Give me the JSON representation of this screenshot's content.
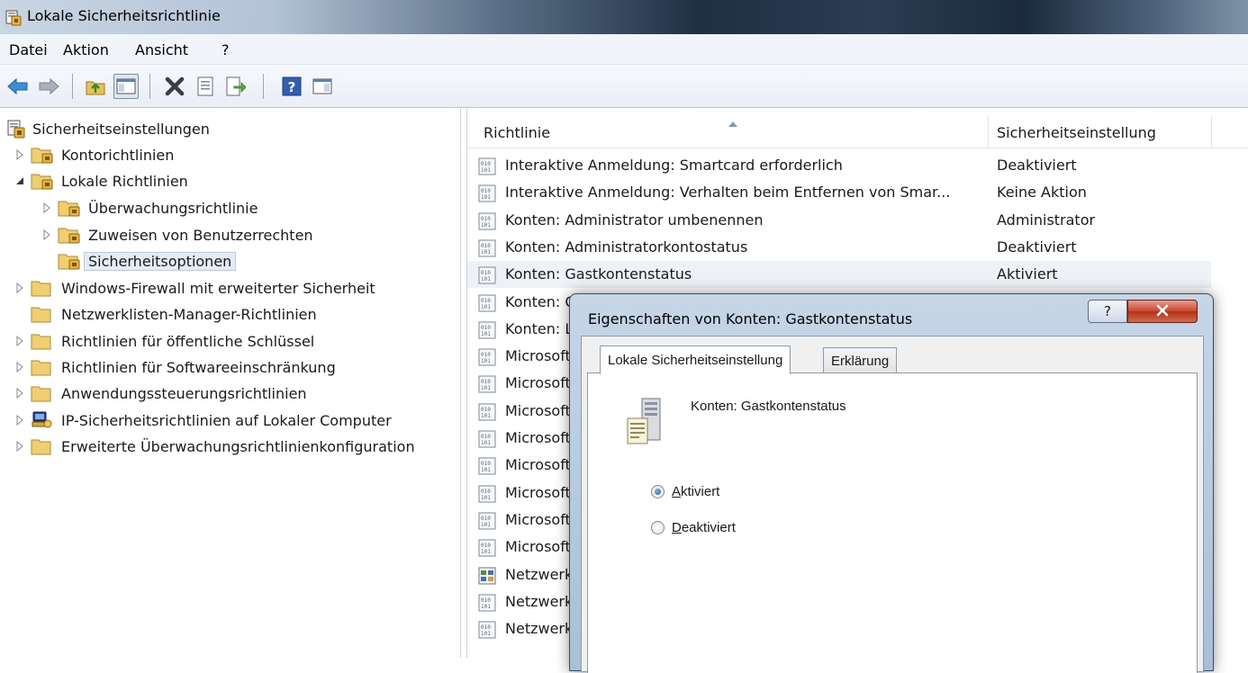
{
  "window": {
    "title": "Lokale Sicherheitsrichtlinie",
    "icon": "security-policy-icon"
  },
  "menu": {
    "items": [
      "Datei",
      "Aktion",
      "Ansicht",
      "?"
    ]
  },
  "toolbar": {
    "buttons": [
      "back-arrow-icon",
      "forward-arrow-icon",
      "up-folder-icon",
      "show-hide-tree-icon",
      "delete-icon",
      "properties-icon",
      "export-list-icon",
      "help-icon",
      "action-pane-icon"
    ]
  },
  "tree": {
    "items": [
      {
        "label": "Sicherheitseinstellungen",
        "icon": "security-settings-icon",
        "level": 0,
        "arrow": "none"
      },
      {
        "label": "Kontorichtlinien",
        "icon": "policy-folder-icon",
        "level": 1,
        "arrow": "collapsed"
      },
      {
        "label": "Lokale Richtlinien",
        "icon": "policy-folder-icon",
        "level": 1,
        "arrow": "expanded"
      },
      {
        "label": "Überwachungsrichtlinie",
        "icon": "policy-folder-icon",
        "level": 2,
        "arrow": "collapsed"
      },
      {
        "label": "Zuweisen von Benutzerrechten",
        "icon": "policy-folder-icon",
        "level": 2,
        "arrow": "collapsed"
      },
      {
        "label": "Sicherheitsoptionen",
        "icon": "policy-folder-icon",
        "level": 2,
        "arrow": "none",
        "selected": true
      },
      {
        "label": "Windows-Firewall mit erweiterter Sicherheit",
        "icon": "folder-icon",
        "level": 1,
        "arrow": "collapsed"
      },
      {
        "label": "Netzwerklisten-Manager-Richtlinien",
        "icon": "folder-icon",
        "level": 1,
        "arrow": "none"
      },
      {
        "label": "Richtlinien für öffentliche Schlüssel",
        "icon": "folder-icon",
        "level": 1,
        "arrow": "collapsed"
      },
      {
        "label": "Richtlinien für Softwareeinschränkung",
        "icon": "folder-icon",
        "level": 1,
        "arrow": "collapsed"
      },
      {
        "label": "Anwendungssteuerungsrichtlinien",
        "icon": "folder-icon",
        "level": 1,
        "arrow": "collapsed"
      },
      {
        "label": "IP-Sicherheitsrichtlinien auf Lokaler Computer",
        "icon": "ip-security-icon",
        "level": 1,
        "arrow": "collapsed"
      },
      {
        "label": "Erweiterte Überwachungsrichtlinienkonfiguration",
        "icon": "folder-icon",
        "level": 1,
        "arrow": "collapsed"
      }
    ]
  },
  "list": {
    "columns": [
      "Richtlinie",
      "Sicherheitseinstellung"
    ],
    "rows": [
      {
        "name": "Interaktive Anmeldung: Smartcard erforderlich",
        "value": "Deaktiviert"
      },
      {
        "name": "Interaktive Anmeldung: Verhalten beim Entfernen von Smar...",
        "value": "Keine Aktion"
      },
      {
        "name": "Konten: Administrator umbenennen",
        "value": "Administrator"
      },
      {
        "name": "Konten: Administratorkontostatus",
        "value": "Deaktiviert"
      },
      {
        "name": "Konten: Gastkontenstatus",
        "value": "Aktiviert",
        "selected": true
      },
      {
        "name": "Konten: G",
        "value": ""
      },
      {
        "name": "Konten: L",
        "value": ""
      },
      {
        "name": "Microsoft",
        "value": ""
      },
      {
        "name": "Microsoft",
        "value": ""
      },
      {
        "name": "Microsoft",
        "value": ""
      },
      {
        "name": "Microsoft",
        "value": ""
      },
      {
        "name": "Microsoft",
        "value": ""
      },
      {
        "name": "Microsoft",
        "value": ""
      },
      {
        "name": "Microsoft",
        "value": ""
      },
      {
        "name": "Microsoft",
        "value": ""
      },
      {
        "name": "Netzwerk",
        "value": "",
        "icon": "network-policy-icon"
      },
      {
        "name": "Netzwerk",
        "value": ""
      },
      {
        "name": "Netzwerk",
        "value": ""
      }
    ]
  },
  "dialog": {
    "title": "Eigenschaften von Konten: Gastkontenstatus",
    "help_label": "?",
    "tabs": [
      "Lokale Sicherheitseinstellung",
      "Erklärung"
    ],
    "active_tab": 0,
    "policy_name": "Konten: Gastkontenstatus",
    "options": [
      {
        "label_access": "A",
        "label_rest": "ktiviert",
        "checked": true
      },
      {
        "label_access": "D",
        "label_rest": "eaktiviert",
        "checked": false
      }
    ]
  },
  "colors": {
    "selection": "#eef1f5",
    "tree_selection": "#e4ecf7",
    "close_button": "#c8472f",
    "folder": "#e8c15a"
  }
}
